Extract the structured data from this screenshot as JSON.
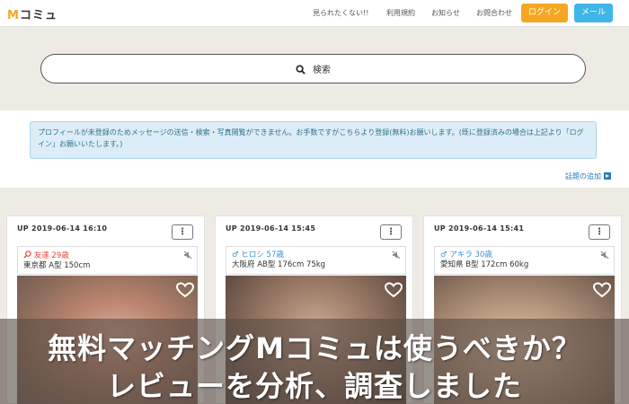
{
  "header": {
    "logo_m": "M",
    "logo_rest": "コミュ",
    "nav": [
      "見られたくない!!",
      "利用規約",
      "お知らせ",
      "お問合わせ"
    ],
    "login_label": "ログイン",
    "mail_label": "メール"
  },
  "search": {
    "label": "検索"
  },
  "notice": {
    "text": "プロフィールが未登録のためメッセージの送信・検索・写真閲覧ができません。お手数ですがこちらより登録(無料)お願いします。(既に登録済みの場合は上記より「ログイン」お願いいたします。)"
  },
  "topic_link": "話題の追加",
  "cards": [
    {
      "date": "UP 2019-06-14 16:10",
      "name": "友達 29歳",
      "gender_icon": "search-heart-icon",
      "name_color": "#e8453c",
      "detail": "東京都 A型 150cm"
    },
    {
      "date": "UP 2019-06-14 15:45",
      "name": "ヒロシ 57歳",
      "gender_icon": "male-icon",
      "name_color": "#3a8fd8",
      "detail": "大阪府 AB型 176cm 75kg"
    },
    {
      "date": "UP 2019-06-14 15:41",
      "name": "アキラ 30歳",
      "gender_icon": "male-icon",
      "name_color": "#3a8fd8",
      "detail": "愛知県 B型 172cm 60kg"
    }
  ],
  "menu_glyph": "⋮",
  "banner": {
    "line1": "無料マッチングMコミュは使うべきか？",
    "line2": "レビューを分析、調査しました"
  }
}
